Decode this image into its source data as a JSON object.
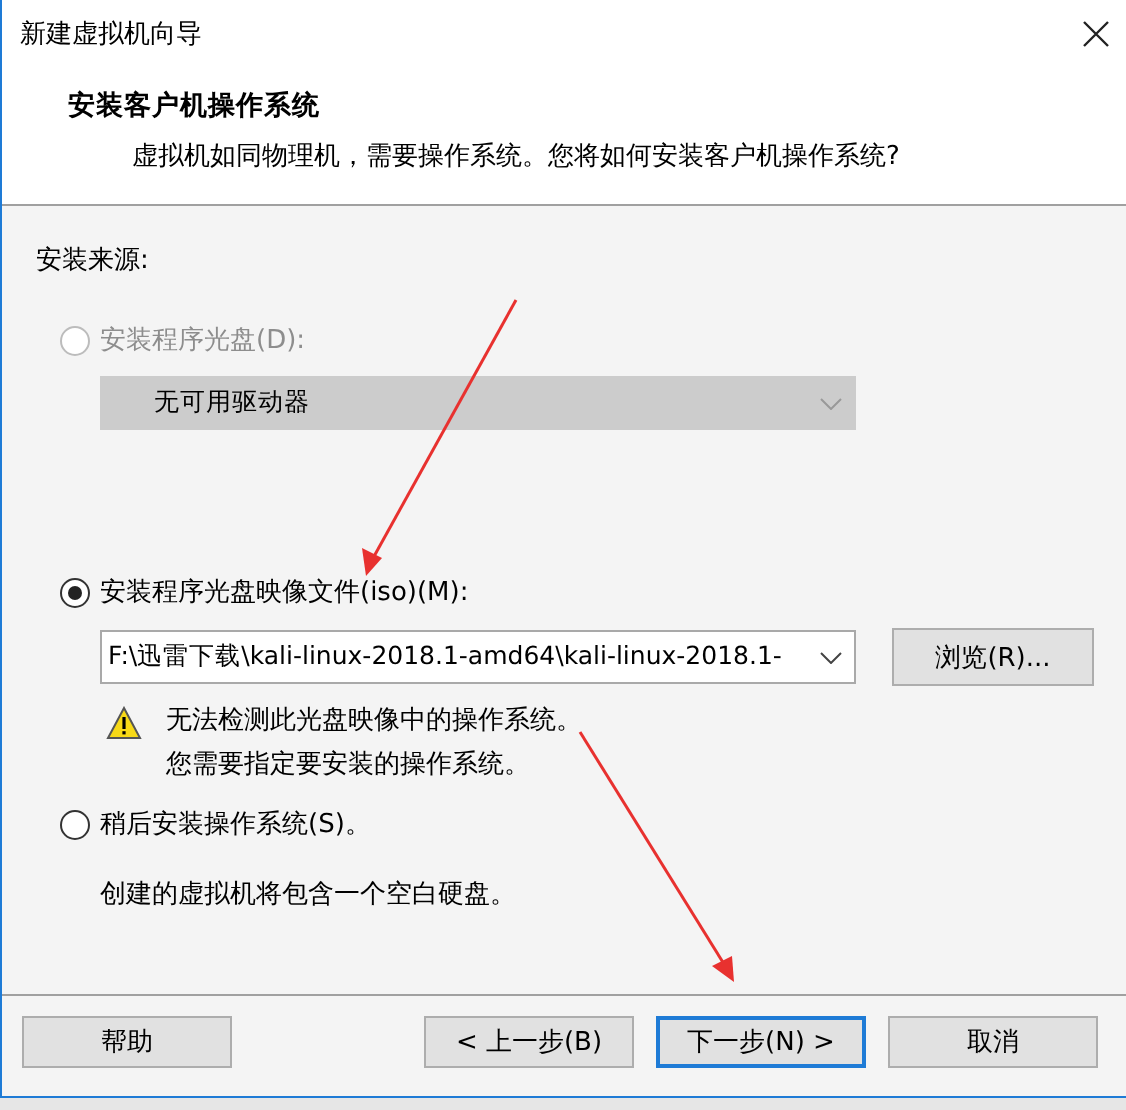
{
  "window": {
    "title": "新建虚拟机向导"
  },
  "header": {
    "title": "安装客户机操作系统",
    "subtitle": "虚拟机如同物理机，需要操作系统。您将如何安装客户机操作系统?"
  },
  "source_label": "安装来源:",
  "options": [
    {
      "kind": "drive",
      "label": "安装程序光盘(D):",
      "selected": false,
      "disabled": true,
      "dropdown": {
        "value": "无可用驱动器",
        "disabled": true
      }
    },
    {
      "kind": "image",
      "label": "安装程序光盘映像文件(iso)(M):",
      "selected": true,
      "disabled": false,
      "dropdown": {
        "value": "F:\\迅雷下载\\kali-linux-2018.1-amd64\\kali-linux-2018.1-",
        "disabled": false
      },
      "browse_button": "浏览(R)...",
      "warning": [
        "无法检测此光盘映像中的操作系统。",
        "您需要指定要安装的操作系统。"
      ]
    },
    {
      "kind": "later",
      "label": "稍后安装操作系统(S)。",
      "selected": false,
      "disabled": false,
      "note": "创建的虚拟机将包含一个空白硬盘。"
    }
  ],
  "buttons": [
    {
      "label": "帮助",
      "focused": false
    },
    {
      "label": "< 上一步(B)",
      "focused": false
    },
    {
      "label": "下一步(N) >",
      "focused": true
    },
    {
      "label": "取消",
      "focused": false
    }
  ]
}
